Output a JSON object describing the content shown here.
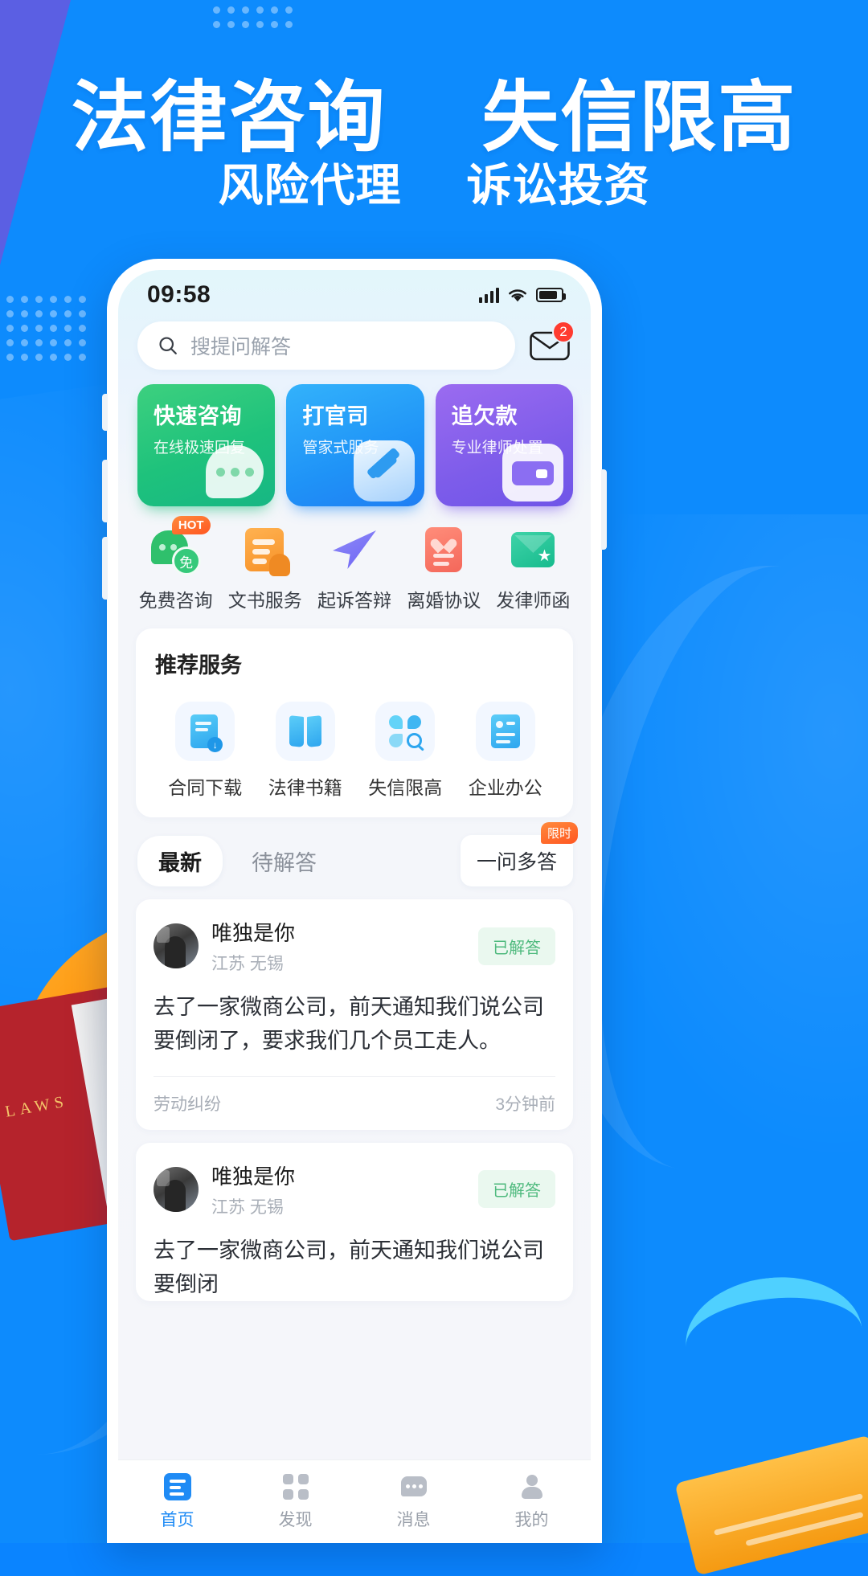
{
  "poster": {
    "headline_left": "法律咨询",
    "headline_right": "失信限高",
    "subhead_left": "风险代理",
    "subhead_right": "诉讼投资",
    "book_title": "LAWS",
    "accent_blue": "#0d8bfd",
    "accent_violet": "#5b5fe3",
    "accent_orange": "#f59a12"
  },
  "status_bar": {
    "time": "09:58",
    "signal_icon": "signal-bars-icon",
    "wifi_icon": "wifi-icon",
    "battery_icon": "battery-icon"
  },
  "search": {
    "icon": "search-icon",
    "placeholder": "搜提问解答",
    "value": "",
    "mail_icon": "mail-icon",
    "mail_badge": "2"
  },
  "service_cards": [
    {
      "title": "快速咨询",
      "subtitle": "在线极速回复",
      "art": "chat-bubble-icon",
      "color": "#1ec27c"
    },
    {
      "title": "打官司",
      "subtitle": "管家式服务",
      "art": "gavel-icon",
      "color": "#1f93f7"
    },
    {
      "title": "追欠款",
      "subtitle": "专业律师处置",
      "art": "wallet-icon",
      "color": "#7d5cea"
    }
  ],
  "quick_actions": [
    {
      "label": "免费咨询",
      "icon": "free-consult-chat-icon",
      "badge": "HOT"
    },
    {
      "label": "文书服务",
      "icon": "document-service-icon",
      "badge": ""
    },
    {
      "label": "起诉答辩",
      "icon": "paper-plane-icon",
      "badge": ""
    },
    {
      "label": "离婚协议",
      "icon": "broken-heart-doc-icon",
      "badge": ""
    },
    {
      "label": "发律师函",
      "icon": "envelope-star-icon",
      "badge": ""
    }
  ],
  "recommend": {
    "title": "推荐服务",
    "items": [
      {
        "label": "合同下载",
        "icon": "contract-download-icon"
      },
      {
        "label": "法律书籍",
        "icon": "law-book-icon"
      },
      {
        "label": "失信限高",
        "icon": "clover-search-icon"
      },
      {
        "label": "企业办公",
        "icon": "company-office-icon"
      }
    ]
  },
  "feed_tabs": {
    "tabs": [
      {
        "label": "最新",
        "active": true
      },
      {
        "label": "待解答",
        "active": false
      }
    ],
    "action_button": {
      "label": "一问多答",
      "badge": "限时"
    }
  },
  "questions": [
    {
      "avatar": "user-avatar",
      "name": "唯独是你",
      "location": "江苏 无锡",
      "status": "已解答",
      "body": "去了一家微商公司，前天通知我们说公司要倒闭了，要求我们几个员工走人。",
      "category": "劳动纠纷",
      "time": "3分钟前"
    },
    {
      "avatar": "user-avatar",
      "name": "唯独是你",
      "location": "江苏 无锡",
      "status": "已解答",
      "body": "去了一家微商公司，前天通知我们说公司要倒闭",
      "category": "",
      "time": ""
    }
  ],
  "tabbar": [
    {
      "label": "首页",
      "icon": "home-icon",
      "active": true
    },
    {
      "label": "发现",
      "icon": "discover-icon",
      "active": false
    },
    {
      "label": "消息",
      "icon": "message-icon",
      "active": false
    },
    {
      "label": "我的",
      "icon": "profile-icon",
      "active": false
    }
  ]
}
